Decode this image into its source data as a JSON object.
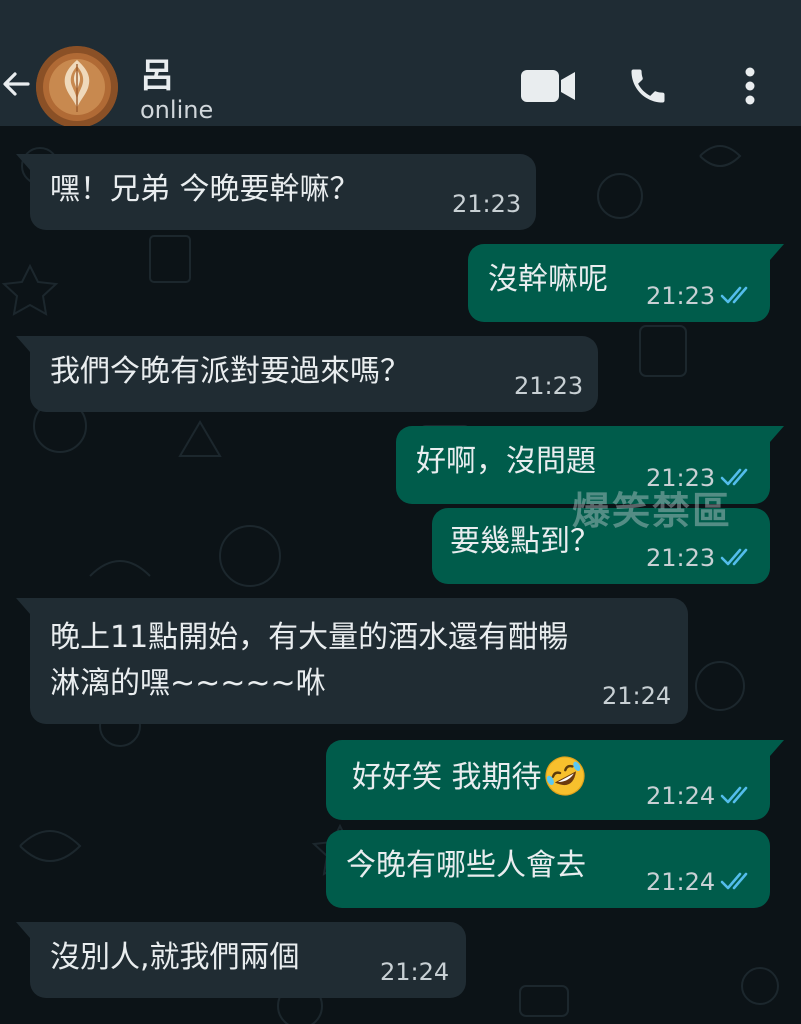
{
  "header": {
    "contact_name": "呂",
    "contact_status": "online",
    "icons": [
      "back-arrow-icon",
      "video-call-icon",
      "phone-icon",
      "more-options-icon"
    ]
  },
  "colors": {
    "header_bg": "#1f2c34",
    "chat_bg": "#0c1317",
    "incoming_bubble": "#202c33",
    "outgoing_bubble": "#005c4b",
    "read_ticks": "#53bdeb"
  },
  "messages": [
    {
      "direction": "incoming",
      "text": "嘿！兄弟 今晚要幹嘛？",
      "time": "21:23"
    },
    {
      "direction": "outgoing",
      "text": "沒幹嘛呢",
      "time": "21:23",
      "status": "read"
    },
    {
      "direction": "incoming",
      "text": "我們今晚有派對要過來嗎？",
      "time": "21:23"
    },
    {
      "direction": "outgoing",
      "text": "好啊，沒問題",
      "time": "21:23",
      "status": "read"
    },
    {
      "direction": "outgoing",
      "text": "要幾點到？",
      "time": "21:23",
      "status": "read"
    },
    {
      "direction": "incoming",
      "lines": [
        "晚上11點開始，有大量的酒水還有酣暢",
        "淋漓的嘿~~~~~咻"
      ],
      "time": "21:24"
    },
    {
      "direction": "outgoing",
      "text": "好好笑 我期待",
      "emoji": "rolling-on-the-floor-laughing",
      "time": "21:24",
      "status": "read"
    },
    {
      "direction": "outgoing",
      "text": "今晚有哪些人會去",
      "time": "21:24",
      "status": "read"
    },
    {
      "direction": "incoming",
      "text": "沒別人,就我們兩個",
      "time": "21:24"
    }
  ],
  "watermark": "爆笑禁區"
}
